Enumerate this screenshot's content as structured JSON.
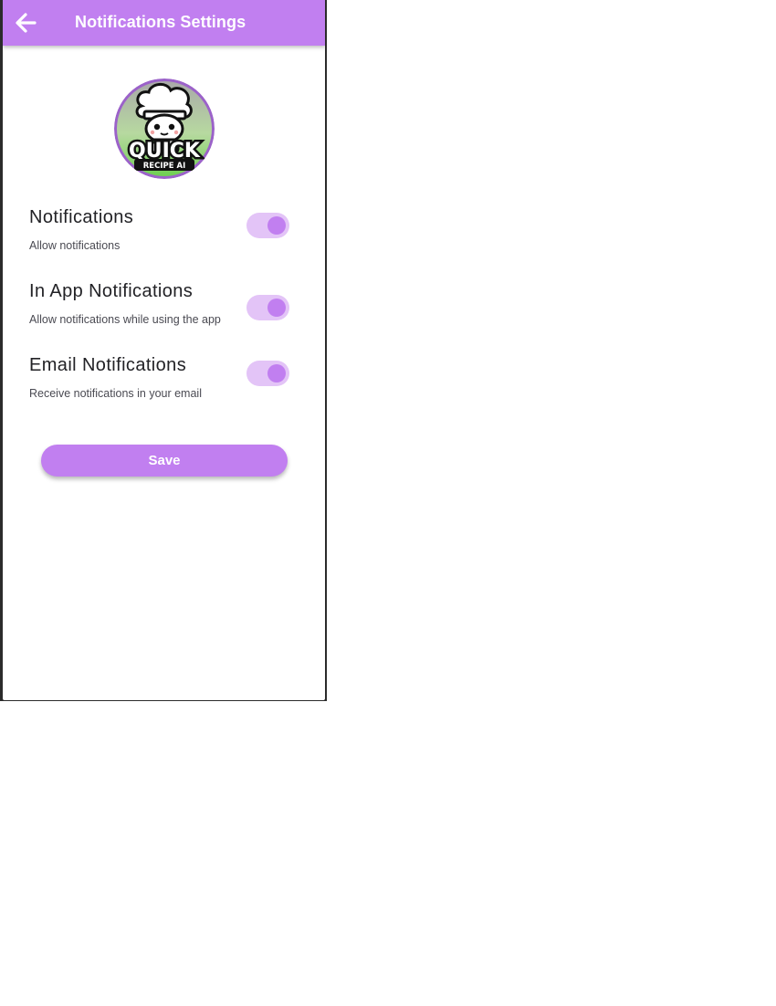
{
  "appbar": {
    "title": "Notifications Settings",
    "back_icon": "arrow-left-icon",
    "color": "#c17ff0"
  },
  "logo": {
    "main_text": "QUICK",
    "sub_text": "RECIPE AI",
    "icon": "chef-mascot-logo"
  },
  "settings": [
    {
      "title": "Notifications",
      "description": "Allow notifications",
      "enabled": true
    },
    {
      "title": "In App Notifications",
      "description": "Allow notifications while using the app",
      "enabled": true
    },
    {
      "title": "Email Notifications",
      "description": "Receive notifications in your email",
      "enabled": true
    }
  ],
  "save_button": {
    "label": "Save"
  },
  "colors": {
    "accent": "#c17ff0",
    "toggle_track": "#e3c4f7"
  }
}
